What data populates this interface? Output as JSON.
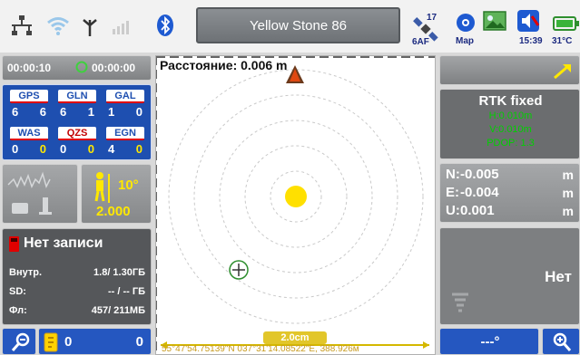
{
  "status_bar": {
    "title": "Yellow Stone 86",
    "satellite_count": "17",
    "satellite_label": "6AF",
    "map_label": "Map",
    "time": "15:39",
    "temperature": "31°C",
    "icons": [
      "network-icon",
      "wifi-icon",
      "antenna-icon",
      "cellular-signal-icon",
      "bluetooth-icon",
      "satellite-icon",
      "map-icon",
      "photo-icon",
      "speaker-icon",
      "battery-icon"
    ]
  },
  "timer": {
    "elapsed": "00:00:10",
    "remaining": "00:00:00"
  },
  "gnss": [
    {
      "label": "GPS",
      "used": "6",
      "extra": "6",
      "label_bg": "#ffffff",
      "label_color": "#1e4fb0",
      "extra_color": "#ffffff"
    },
    {
      "label": "GLN",
      "used": "6",
      "extra": "1",
      "label_bg": "#ffffff",
      "label_color": "#1e4fb0",
      "extra_color": "#ffffff"
    },
    {
      "label": "GAL",
      "used": "1",
      "extra": "0",
      "label_bg": "#ffffff",
      "label_color": "#1e4fb0",
      "extra_color": "#ffffff"
    },
    {
      "label": "WAS",
      "used": "0",
      "extra": "0",
      "label_bg": "#ffffff",
      "label_color": "#1e4fb0",
      "extra_color": "#ffe800"
    },
    {
      "label": "QZS",
      "used": "0",
      "extra": "0",
      "label_bg": "#ffffff",
      "label_color": "#c00000",
      "extra_color": "#ffe800"
    },
    {
      "label": "EGN",
      "used": "4",
      "extra": "0",
      "label_bg": "#ffffff",
      "label_color": "#1e4fb0",
      "extra_color": "#ffe800"
    }
  ],
  "tilt": {
    "angle": "10°",
    "height": "2.000"
  },
  "record": {
    "status": "Нет записи",
    "internal_label": "Внутр.",
    "internal_value": "1.8/ 1.30ГБ",
    "sd_label": "SD:",
    "sd_value": "-- / -- ГБ",
    "flash_label": "Фл:",
    "flash_value": "457/ 211МБ"
  },
  "map": {
    "distance_label": "Расстояние: 0.006 m",
    "scale": "2.0cm",
    "coordinates": "55°47'54.75139\"N 037°31'14.08522\"E, 388.926м"
  },
  "rtk": {
    "status": "RTK fixed",
    "line1": "H:0.010m",
    "line2": "V:0.010m",
    "line3": "PDOP: 1.3"
  },
  "neu": {
    "n_label": "N:",
    "n_value": "-0.005",
    "e_label": "E:",
    "e_value": "-0.004",
    "u_label": "U:",
    "u_value": "0.001",
    "unit": "m"
  },
  "point": {
    "label": "Нет"
  },
  "bottom": {
    "left_count_a": "0",
    "left_count_b": "0",
    "angle": "---°"
  },
  "colors": {
    "blue_panel": "#1e4fb0",
    "yellow": "#ffe800",
    "rtk_green": "#00d000",
    "record_red": "#e00000"
  }
}
